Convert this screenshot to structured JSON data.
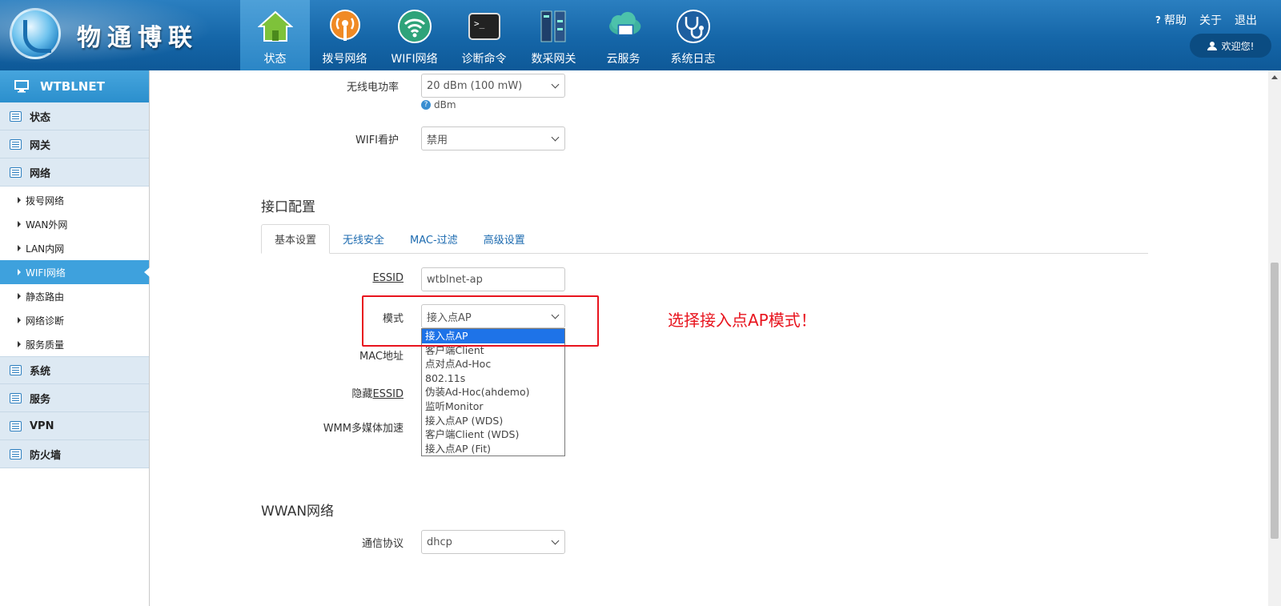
{
  "header": {
    "brand": "物通博联",
    "nav": [
      {
        "label": "状态",
        "icon": "house-icon",
        "active": true
      },
      {
        "label": "拨号网络",
        "icon": "broadcast-icon"
      },
      {
        "label": "WIFI网络",
        "icon": "wifi-icon"
      },
      {
        "label": "诊断命令",
        "icon": "terminal-icon"
      },
      {
        "label": "数采网关",
        "icon": "gateway-icon"
      },
      {
        "label": "云服务",
        "icon": "cloud-icon"
      },
      {
        "label": "系统日志",
        "icon": "stethoscope-icon"
      }
    ],
    "links": {
      "help": "帮助",
      "about": "关于",
      "logout": "退出"
    },
    "welcome": "欢迎您!"
  },
  "sidebar": {
    "title": "WTBLNET",
    "groups_top": [
      "状态",
      "网关",
      "网络"
    ],
    "network_items": [
      "拨号网络",
      "WAN外网",
      "LAN内网",
      "WIFI网络",
      "静态路由",
      "网络诊断",
      "服务质量"
    ],
    "active_item": "WIFI网络",
    "groups_bottom": [
      "系统",
      "服务",
      "VPN",
      "防火墙"
    ]
  },
  "main": {
    "tx_power": {
      "label": "无线电功率",
      "value": "20 dBm (100 mW)",
      "hint": "dBm"
    },
    "wifi_watchdog": {
      "label": "WIFI看护",
      "value": "禁用"
    },
    "iface_section": "接口配置",
    "tabs": [
      "基本设置",
      "无线安全",
      "MAC-过滤",
      "高级设置"
    ],
    "essid": {
      "label": "ESSID",
      "value": "wtblnet-ap"
    },
    "mode": {
      "label": "模式",
      "value": "接入点AP",
      "options": [
        "接入点AP",
        "客户端Client",
        "点对点Ad-Hoc",
        "802.11s",
        "伪装Ad-Hoc(ahdemo)",
        "监听Monitor",
        "接入点AP (WDS)",
        "客户端Client (WDS)",
        "接入点AP (Fit)"
      ]
    },
    "mac_label": "MAC地址",
    "hide_essid_label_prefix": "隐藏",
    "hide_essid_label_suffix": "ESSID",
    "wmm_label": "WMM多媒体加速",
    "wwan_section": "WWAN网络",
    "protocol": {
      "label": "通信协议",
      "value": "dhcp"
    },
    "annotation": "选择接入点AP模式！"
  },
  "colors": {
    "accent": "#1566a8",
    "active_tab_side": "#3ea1dd",
    "annotation": "#e8141e",
    "selected_option": "#1e73e8"
  }
}
